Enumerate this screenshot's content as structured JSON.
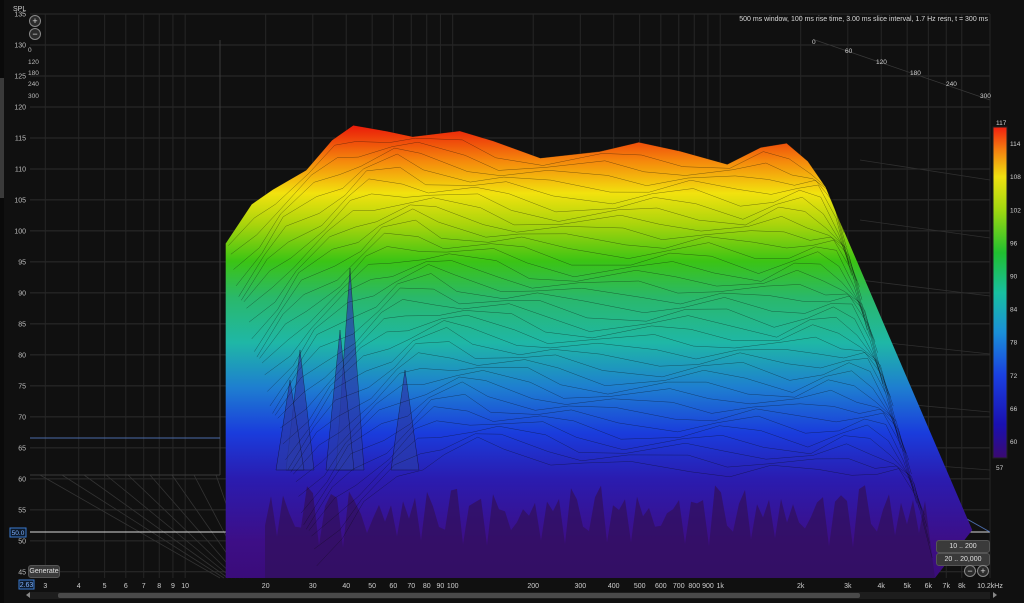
{
  "chart_data": {
    "type": "waterfall",
    "ylabel": "SPL",
    "settings_text": "500 ms window, 100 ms rise time, 3.00 ms slice interval, 1.7 Hz resn, t = 300 ms",
    "ylim": [
      44,
      136
    ],
    "yticks": [
      45,
      50,
      55,
      60,
      65,
      70,
      75,
      80,
      85,
      90,
      95,
      100,
      105,
      110,
      115,
      120,
      125,
      130,
      135
    ],
    "xlim_hz": [
      2.63,
      10200
    ],
    "xticks": [
      {
        "hz": 3,
        "label": "3"
      },
      {
        "hz": 4,
        "label": "4"
      },
      {
        "hz": 5,
        "label": "5"
      },
      {
        "hz": 6,
        "label": "6"
      },
      {
        "hz": 7,
        "label": "7"
      },
      {
        "hz": 8,
        "label": "8"
      },
      {
        "hz": 9,
        "label": "9"
      },
      {
        "hz": 10,
        "label": "10"
      },
      {
        "hz": 20,
        "label": "20"
      },
      {
        "hz": 30,
        "label": "30"
      },
      {
        "hz": 40,
        "label": "40"
      },
      {
        "hz": 50,
        "label": "50"
      },
      {
        "hz": 60,
        "label": "60"
      },
      {
        "hz": 70,
        "label": "70"
      },
      {
        "hz": 80,
        "label": "80"
      },
      {
        "hz": 90,
        "label": "90"
      },
      {
        "hz": 100,
        "label": "100"
      },
      {
        "hz": 200,
        "label": "200"
      },
      {
        "hz": 300,
        "label": "300"
      },
      {
        "hz": 400,
        "label": "400"
      },
      {
        "hz": 500,
        "label": "500"
      },
      {
        "hz": 600,
        "label": "600"
      },
      {
        "hz": 700,
        "label": "700"
      },
      {
        "hz": 800,
        "label": "800"
      },
      {
        "hz": 900,
        "label": "900"
      },
      {
        "hz": 1000,
        "label": "1k"
      },
      {
        "hz": 2000,
        "label": "2k"
      },
      {
        "hz": 3000,
        "label": "3k"
      },
      {
        "hz": 4000,
        "label": "4k"
      },
      {
        "hz": 5000,
        "label": "5k"
      },
      {
        "hz": 6000,
        "label": "6k"
      },
      {
        "hz": 7000,
        "label": "7k"
      },
      {
        "hz": 8000,
        "label": "8k"
      },
      {
        "hz": 10200,
        "label": "10.2kHz"
      }
    ],
    "x_start_label": "2.63",
    "level_marker": "50.0",
    "time_axis_left": [
      "0",
      "120",
      "180",
      "240",
      "300"
    ],
    "time_axis_right": [
      "0",
      "60",
      "120",
      "180",
      "240",
      "300"
    ],
    "colorbar": {
      "min": 57,
      "max": 117,
      "ticks": [
        57,
        60,
        66,
        72,
        78,
        84,
        90,
        96,
        102,
        108,
        114,
        117
      ]
    },
    "front_slice_t0": {
      "hz": [
        20,
        25,
        30,
        40,
        50,
        60,
        80,
        100,
        150,
        200,
        300,
        500,
        700,
        1000,
        1500,
        2000,
        2500,
        3000,
        3500,
        4000
      ],
      "spl": [
        98,
        103,
        107,
        111,
        114,
        116,
        117,
        116,
        115,
        114,
        113,
        113,
        113,
        113,
        112,
        113,
        113,
        112,
        108,
        100
      ]
    },
    "colors": {
      "background": "#101010",
      "grid": "#3a3a3a"
    }
  },
  "controls": {
    "generate_label": "Generate",
    "range_btn_1": "10 .. 200",
    "range_btn_2": "20 .. 20,000",
    "zoom_in": "+",
    "zoom_out": "−"
  }
}
